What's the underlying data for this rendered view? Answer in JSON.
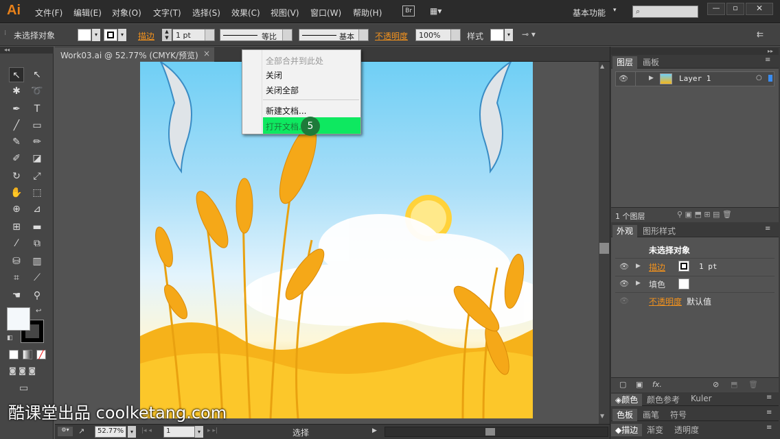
{
  "app": {
    "logo": "Ai"
  },
  "menu": [
    "文件(F)",
    "编辑(E)",
    "对象(O)",
    "文字(T)",
    "选择(S)",
    "效果(C)",
    "视图(V)",
    "窗口(W)",
    "帮助(H)"
  ],
  "menubar": {
    "bridge": "Br",
    "workspace": "基本功能",
    "search_placeholder": ""
  },
  "control": {
    "selection_label": "未选择对象",
    "stroke_label": "描边",
    "stroke_weight": "1 pt",
    "profile_label": "等比",
    "brush_label": "基本",
    "opacity_label": "不透明度",
    "opacity_value": "100%",
    "style_label": "样式"
  },
  "document": {
    "tab_title": "Work03.ai @ 52.77% (CMYK/预览)",
    "close": "×"
  },
  "context_menu": {
    "items": [
      "全部合并到此处",
      "关闭",
      "关闭全部",
      "新建文档...",
      "打开文档..."
    ],
    "highlighted": "打开文档...",
    "step": "5"
  },
  "status": {
    "zoom": "52.77%",
    "page": "1",
    "tool": "选择"
  },
  "layers_panel": {
    "tabs": [
      "图层",
      "画板"
    ],
    "layer_name": "Layer 1",
    "count": "1 个图层"
  },
  "appearance_panel": {
    "tabs": [
      "外观",
      "图形样式"
    ],
    "title": "未选择对象",
    "stroke_label": "描边",
    "stroke_value": "1 pt",
    "fill_label": "填色",
    "opacity_label": "不透明度",
    "opacity_value": "默认值",
    "fx": "fx."
  },
  "color_panels": {
    "tabs1": [
      "颜色",
      "颜色参考",
      "Kuler"
    ],
    "tabs2": [
      "色板",
      "画笔",
      "符号"
    ],
    "tabs3": [
      "描边",
      "渐变",
      "透明度"
    ]
  },
  "watermark": "酷课堂出品 coolketang.com",
  "colors": {
    "accent": "#f2921d",
    "highlight": "#0ee860"
  }
}
